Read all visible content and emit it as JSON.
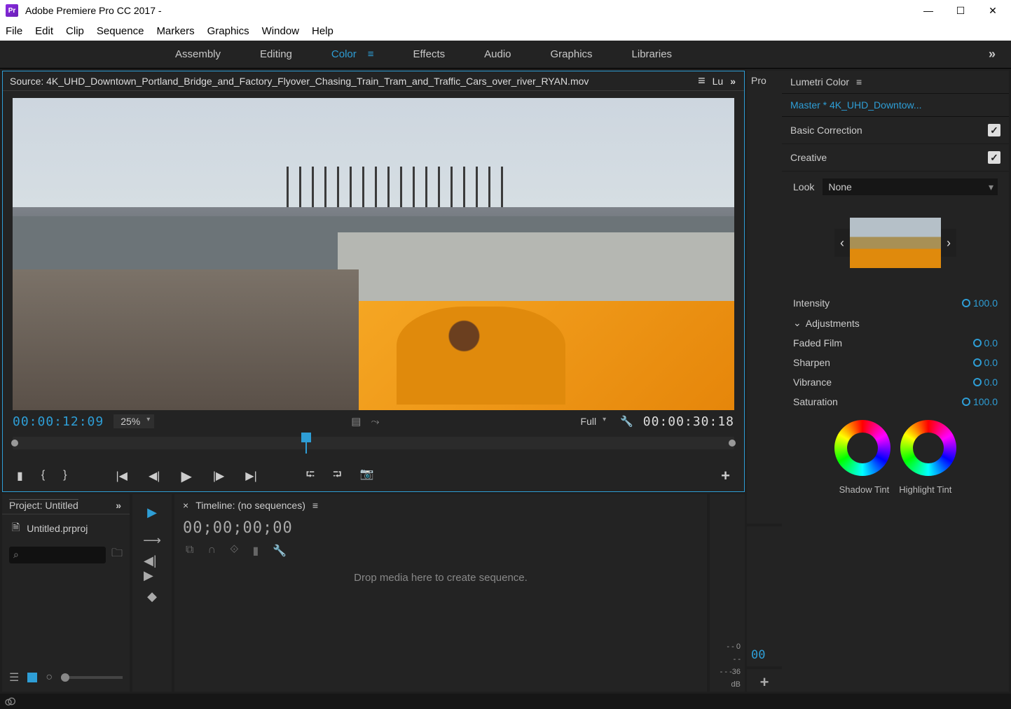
{
  "titlebar": {
    "app_icon_text": "Pr",
    "title": "Adobe Premiere Pro CC 2017 -"
  },
  "menubar": [
    "File",
    "Edit",
    "Clip",
    "Sequence",
    "Markers",
    "Graphics",
    "Window",
    "Help"
  ],
  "workspaces": {
    "items": [
      "Assembly",
      "Editing",
      "Color",
      "Effects",
      "Audio",
      "Graphics",
      "Libraries"
    ],
    "active": "Color"
  },
  "source": {
    "tab_label": "Source: 4K_UHD_Downtown_Portland_Bridge_and_Factory_Flyover_Chasing_Train_Tram_and_Traffic_Cars_over_river_RYAN.mov",
    "tc_current": "00:00:12:09",
    "zoom": "25%",
    "resolution": "Full",
    "tc_total": "00:00:30:18",
    "hidden_tab1": "Lu",
    "hidden_tab2": "Pro"
  },
  "project": {
    "header": "Project: Untitled",
    "filename": "Untitled.prproj"
  },
  "timeline": {
    "header": "Timeline: (no sequences)",
    "tc": "00;00;00;00",
    "drop_hint": "Drop media here to create sequence."
  },
  "meters": {
    "l0": "0",
    "l36": "-36",
    "unit": "dB",
    "dash": "- -",
    "dash2": "- -",
    "dash3": "- -"
  },
  "lumetri": {
    "panel_title": "Lumetri Color",
    "master": "Master * 4K_UHD_Downtow...",
    "basic": "Basic Correction",
    "creative": "Creative",
    "look_label": "Look",
    "look_value": "None",
    "intensity_label": "Intensity",
    "intensity_value": "100.0",
    "adjustments_label": "Adjustments",
    "faded_label": "Faded Film",
    "faded_value": "0.0",
    "sharpen_label": "Sharpen",
    "sharpen_value": "0.0",
    "vibrance_label": "Vibrance",
    "vibrance_value": "0.0",
    "saturation_label": "Saturation",
    "saturation_value": "100.0",
    "shadow_label": "Shadow Tint",
    "highlight_label": "Highlight Tint"
  },
  "scopes_tc": "00"
}
